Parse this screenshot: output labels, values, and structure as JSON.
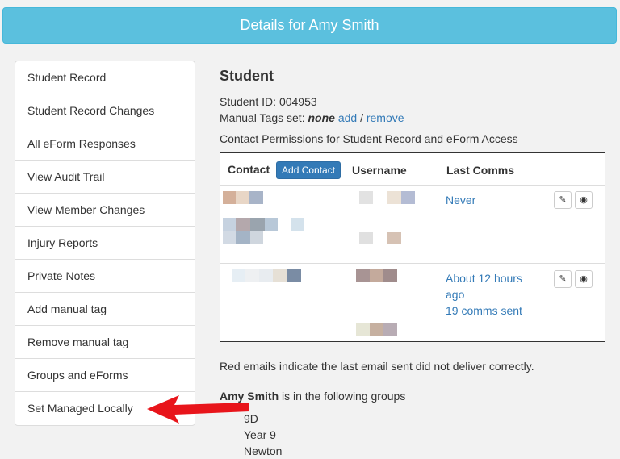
{
  "header": {
    "title": "Details for Amy Smith"
  },
  "sidebar": {
    "items": [
      {
        "label": "Student Record"
      },
      {
        "label": "Student Record Changes"
      },
      {
        "label": "All eForm Responses"
      },
      {
        "label": "View Audit Trail"
      },
      {
        "label": "View Member Changes"
      },
      {
        "label": "Injury Reports"
      },
      {
        "label": "Private Notes"
      },
      {
        "label": "Add manual tag"
      },
      {
        "label": "Remove manual tag"
      },
      {
        "label": "Groups and eForms"
      },
      {
        "label": "Set Managed Locally"
      }
    ]
  },
  "main": {
    "section_title": "Student",
    "student_id_label": "Student ID:",
    "student_id": "004953",
    "manual_tags_label": "Manual Tags set:",
    "manual_tags_value": "none",
    "tag_add": "add",
    "tag_sep": " / ",
    "tag_remove": "remove",
    "permissions_text": "Contact Permissions for Student Record and eForm Access"
  },
  "contacts_table": {
    "headers": {
      "contact": "Contact",
      "add_contact_button": "Add Contact",
      "username": "Username",
      "last_comms": "Last Comms"
    },
    "rows": [
      {
        "last_comms": "Never",
        "comms_count": ""
      },
      {
        "last_comms": "About 12 hours ago",
        "comms_count": "19 comms sent"
      }
    ]
  },
  "note": "Red emails indicate the last email sent did not deliver correctly.",
  "groups": {
    "student_name": "Amy Smith",
    "suffix": " is in the following groups",
    "list": [
      "9D",
      "Year 9",
      "Newton"
    ]
  },
  "colors": {
    "header_bg": "#5bc0de",
    "link": "#337ab7",
    "arrow": "#e8151b"
  }
}
